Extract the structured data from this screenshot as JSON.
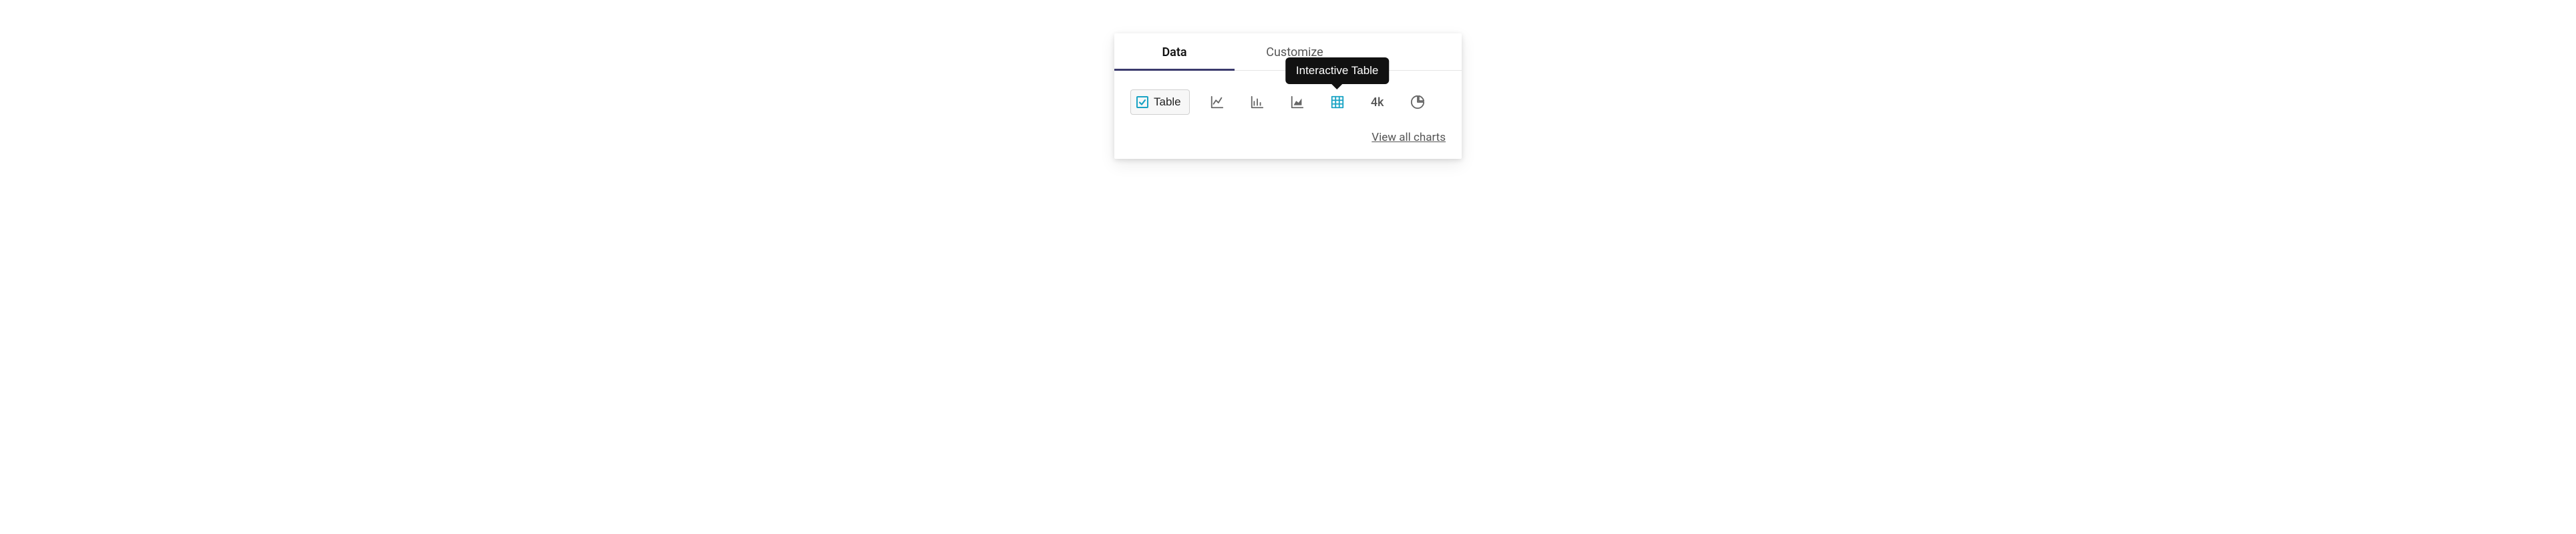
{
  "tabs": {
    "data": "Data",
    "customize": "Customize"
  },
  "toolbar": {
    "table_label": "Table",
    "k4_label": "4k",
    "tooltip": "Interactive Table"
  },
  "footer": {
    "view_all": "View all charts"
  }
}
